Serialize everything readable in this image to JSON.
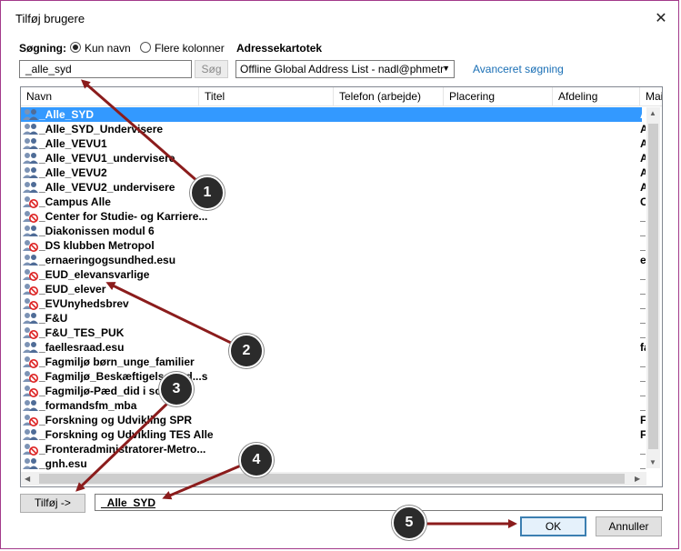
{
  "dialog": {
    "title": "Tilføj brugere",
    "close_glyph": "✕"
  },
  "search": {
    "label": "Søgning:",
    "option_name": "Kun navn",
    "option_columns": "Flere kolonner",
    "value": "_alle_syd",
    "button": "Søg"
  },
  "addressbook": {
    "label": "Adressekartotek",
    "value": "Offline Global Address List - nadl@phmetr",
    "advanced_link": "Avanceret søgning"
  },
  "columns": [
    "Navn",
    "Titel",
    "Telefon (arbejde)",
    "Placering",
    "Afdeling",
    "Mai"
  ],
  "rows": [
    {
      "name": "_Alle_SYD",
      "edge": "A",
      "type": "group",
      "selected": true
    },
    {
      "name": "_Alle_SYD_Undervisere",
      "edge": "A",
      "type": "group"
    },
    {
      "name": "_Alle_VEVU1",
      "edge": "A",
      "type": "group"
    },
    {
      "name": "_Alle_VEVU1_undervisere",
      "edge": "A",
      "type": "group"
    },
    {
      "name": "_Alle_VEVU2",
      "edge": "A",
      "type": "group"
    },
    {
      "name": "_Alle_VEVU2_undervisere",
      "edge": "A",
      "type": "group"
    },
    {
      "name": "_Campus Alle",
      "edge": "C",
      "type": "blocked"
    },
    {
      "name": "_Center for Studie- og Karriere...",
      "edge": "_",
      "type": "blocked"
    },
    {
      "name": "_Diakonissen modul 6",
      "edge": "_",
      "type": "group"
    },
    {
      "name": "_DS klubben Metropol",
      "edge": "_",
      "type": "blocked"
    },
    {
      "name": "_ernaeringogsundhed.esu",
      "edge": "e",
      "type": "group"
    },
    {
      "name": "_EUD_elevansvarlige",
      "edge": "_",
      "type": "blocked"
    },
    {
      "name": "_EUD_elever",
      "edge": "_",
      "type": "blocked"
    },
    {
      "name": "_EVUnyhedsbrev",
      "edge": "_",
      "type": "blocked"
    },
    {
      "name": "_F&U",
      "edge": "_",
      "type": "group"
    },
    {
      "name": "_F&U_TES_PUK",
      "edge": "_",
      "type": "blocked"
    },
    {
      "name": "_faellesraad.esu",
      "edge": "fa",
      "type": "group"
    },
    {
      "name": "_Fagmiljø børn_unge_familier",
      "edge": "_",
      "type": "blocked"
    },
    {
      "name": "_Fagmiljø_Beskæftigelsesind...s",
      "edge": "_",
      "type": "blocked"
    },
    {
      "name": "_Fagmiljø-Pæd_did i social...",
      "edge": "_",
      "type": "blocked"
    },
    {
      "name": "_formandsfm_mba",
      "edge": "_",
      "type": "group"
    },
    {
      "name": "_Forskning og Udvikling SPR",
      "edge": "F",
      "type": "blocked"
    },
    {
      "name": "_Forskning og Udvikling TES Alle",
      "edge": "F",
      "type": "group"
    },
    {
      "name": "_Fronteradministratorer-Metro...",
      "edge": "_",
      "type": "blocked"
    },
    {
      "name": "_gnh.esu",
      "edge": "_",
      "type": "group"
    }
  ],
  "add": {
    "button": "Tilføj ->",
    "value": "_Alle_SYD"
  },
  "footer": {
    "ok": "OK",
    "cancel": "Annuller"
  },
  "callouts": [
    "1",
    "2",
    "3",
    "4",
    "5"
  ],
  "colors": {
    "selection": "#3399ff",
    "callout_arrow": "#8b1c1c",
    "link": "#1a6fb5"
  }
}
